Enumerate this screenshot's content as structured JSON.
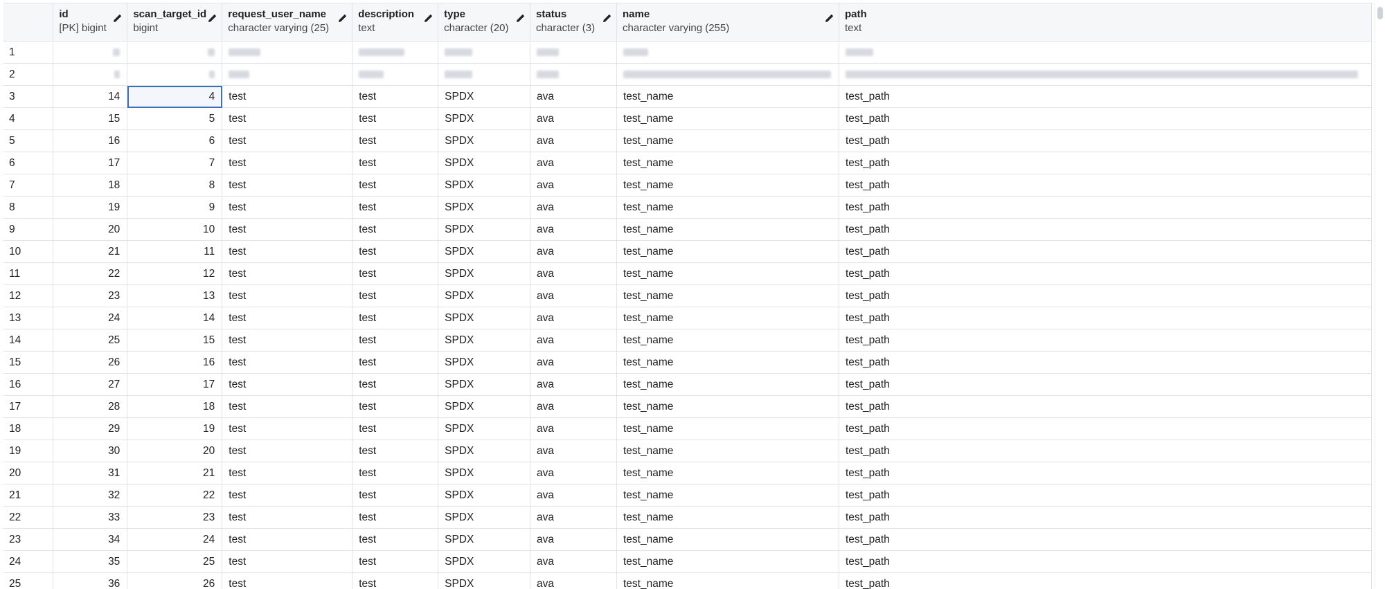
{
  "columns": [
    {
      "name": "id",
      "type": "[PK] bigint"
    },
    {
      "name": "scan_target_id",
      "type": "bigint"
    },
    {
      "name": "request_user_name",
      "type": "character varying (25)"
    },
    {
      "name": "description",
      "type": "text"
    },
    {
      "name": "type",
      "type": "character (20)"
    },
    {
      "name": "status",
      "type": "character (3)"
    },
    {
      "name": "name",
      "type": "character varying (255)"
    },
    {
      "name": "path",
      "type": "text"
    }
  ],
  "rows": [
    {
      "n": "1",
      "redacted": true
    },
    {
      "n": "2",
      "redacted": true
    },
    {
      "n": "3",
      "id": "14",
      "scan_target_id": "4",
      "request_user_name": "test",
      "description": "test",
      "type": "SPDX",
      "status": "ava",
      "name": "test_name",
      "path": "test_path"
    },
    {
      "n": "4",
      "id": "15",
      "scan_target_id": "5",
      "request_user_name": "test",
      "description": "test",
      "type": "SPDX",
      "status": "ava",
      "name": "test_name",
      "path": "test_path"
    },
    {
      "n": "5",
      "id": "16",
      "scan_target_id": "6",
      "request_user_name": "test",
      "description": "test",
      "type": "SPDX",
      "status": "ava",
      "name": "test_name",
      "path": "test_path"
    },
    {
      "n": "6",
      "id": "17",
      "scan_target_id": "7",
      "request_user_name": "test",
      "description": "test",
      "type": "SPDX",
      "status": "ava",
      "name": "test_name",
      "path": "test_path"
    },
    {
      "n": "7",
      "id": "18",
      "scan_target_id": "8",
      "request_user_name": "test",
      "description": "test",
      "type": "SPDX",
      "status": "ava",
      "name": "test_name",
      "path": "test_path"
    },
    {
      "n": "8",
      "id": "19",
      "scan_target_id": "9",
      "request_user_name": "test",
      "description": "test",
      "type": "SPDX",
      "status": "ava",
      "name": "test_name",
      "path": "test_path"
    },
    {
      "n": "9",
      "id": "20",
      "scan_target_id": "10",
      "request_user_name": "test",
      "description": "test",
      "type": "SPDX",
      "status": "ava",
      "name": "test_name",
      "path": "test_path"
    },
    {
      "n": "10",
      "id": "21",
      "scan_target_id": "11",
      "request_user_name": "test",
      "description": "test",
      "type": "SPDX",
      "status": "ava",
      "name": "test_name",
      "path": "test_path"
    },
    {
      "n": "11",
      "id": "22",
      "scan_target_id": "12",
      "request_user_name": "test",
      "description": "test",
      "type": "SPDX",
      "status": "ava",
      "name": "test_name",
      "path": "test_path"
    },
    {
      "n": "12",
      "id": "23",
      "scan_target_id": "13",
      "request_user_name": "test",
      "description": "test",
      "type": "SPDX",
      "status": "ava",
      "name": "test_name",
      "path": "test_path"
    },
    {
      "n": "13",
      "id": "24",
      "scan_target_id": "14",
      "request_user_name": "test",
      "description": "test",
      "type": "SPDX",
      "status": "ava",
      "name": "test_name",
      "path": "test_path"
    },
    {
      "n": "14",
      "id": "25",
      "scan_target_id": "15",
      "request_user_name": "test",
      "description": "test",
      "type": "SPDX",
      "status": "ava",
      "name": "test_name",
      "path": "test_path"
    },
    {
      "n": "15",
      "id": "26",
      "scan_target_id": "16",
      "request_user_name": "test",
      "description": "test",
      "type": "SPDX",
      "status": "ava",
      "name": "test_name",
      "path": "test_path"
    },
    {
      "n": "16",
      "id": "27",
      "scan_target_id": "17",
      "request_user_name": "test",
      "description": "test",
      "type": "SPDX",
      "status": "ava",
      "name": "test_name",
      "path": "test_path"
    },
    {
      "n": "17",
      "id": "28",
      "scan_target_id": "18",
      "request_user_name": "test",
      "description": "test",
      "type": "SPDX",
      "status": "ava",
      "name": "test_name",
      "path": "test_path"
    },
    {
      "n": "18",
      "id": "29",
      "scan_target_id": "19",
      "request_user_name": "test",
      "description": "test",
      "type": "SPDX",
      "status": "ava",
      "name": "test_name",
      "path": "test_path"
    },
    {
      "n": "19",
      "id": "30",
      "scan_target_id": "20",
      "request_user_name": "test",
      "description": "test",
      "type": "SPDX",
      "status": "ava",
      "name": "test_name",
      "path": "test_path"
    },
    {
      "n": "20",
      "id": "31",
      "scan_target_id": "21",
      "request_user_name": "test",
      "description": "test",
      "type": "SPDX",
      "status": "ava",
      "name": "test_name",
      "path": "test_path"
    },
    {
      "n": "21",
      "id": "32",
      "scan_target_id": "22",
      "request_user_name": "test",
      "description": "test",
      "type": "SPDX",
      "status": "ava",
      "name": "test_name",
      "path": "test_path"
    },
    {
      "n": "22",
      "id": "33",
      "scan_target_id": "23",
      "request_user_name": "test",
      "description": "test",
      "type": "SPDX",
      "status": "ava",
      "name": "test_name",
      "path": "test_path"
    },
    {
      "n": "23",
      "id": "34",
      "scan_target_id": "24",
      "request_user_name": "test",
      "description": "test",
      "type": "SPDX",
      "status": "ava",
      "name": "test_name",
      "path": "test_path"
    },
    {
      "n": "24",
      "id": "35",
      "scan_target_id": "25",
      "request_user_name": "test",
      "description": "test",
      "type": "SPDX",
      "status": "ava",
      "name": "test_name",
      "path": "test_path"
    },
    {
      "n": "25",
      "id": "36",
      "scan_target_id": "26",
      "request_user_name": "test",
      "description": "test",
      "type": "SPDX",
      "status": "ava",
      "name": "test_name",
      "path": "test_path"
    }
  ],
  "selected_cell": {
    "row": "3",
    "column": "scan_target_id"
  },
  "icons": {
    "column_edit": "pencil-icon"
  },
  "colors": {
    "grid_line": "#dfe3e8",
    "header_bg": "#f6f7f9",
    "selection": "#3b6fb6"
  }
}
